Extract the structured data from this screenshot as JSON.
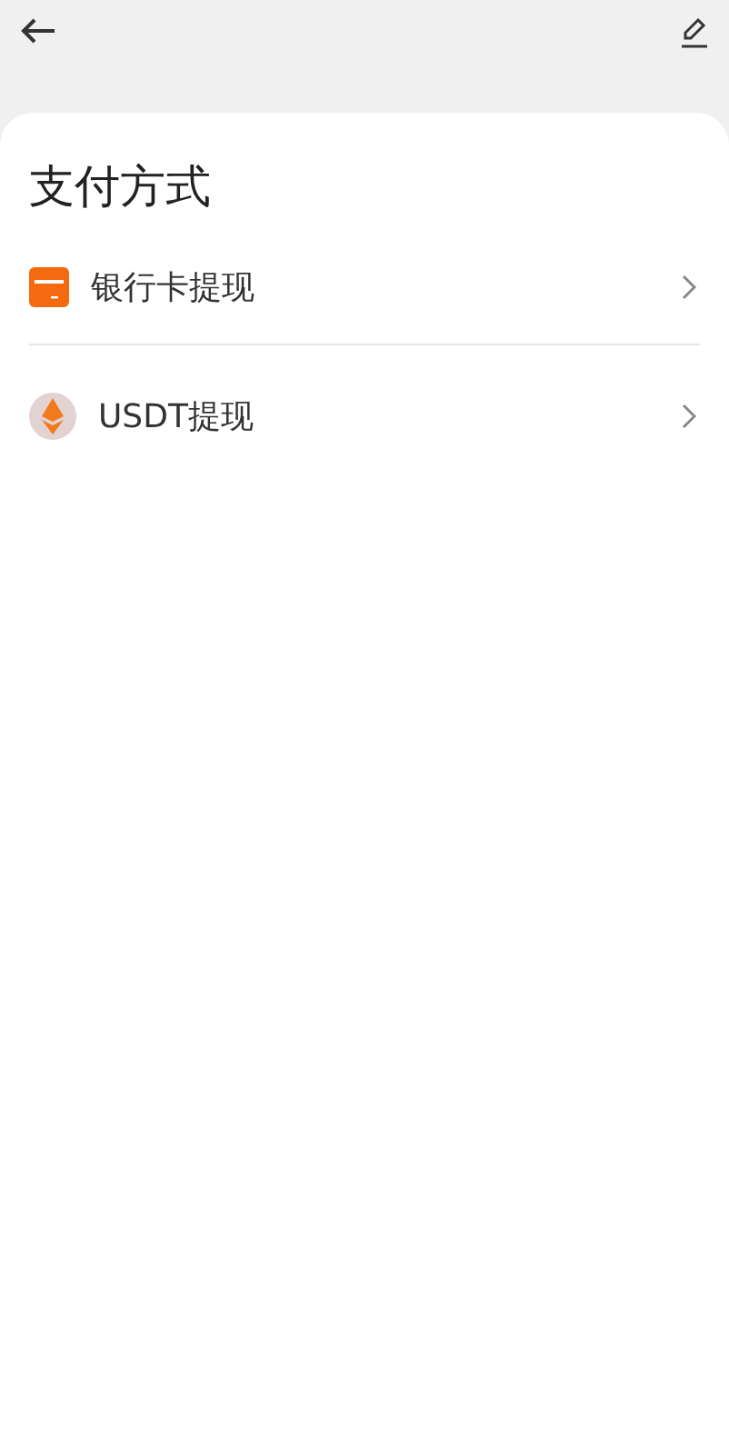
{
  "title": "支付方式",
  "methods": [
    {
      "kind": "bank",
      "label": "银行卡提现"
    },
    {
      "kind": "usdt",
      "label": "USDT提现"
    }
  ]
}
